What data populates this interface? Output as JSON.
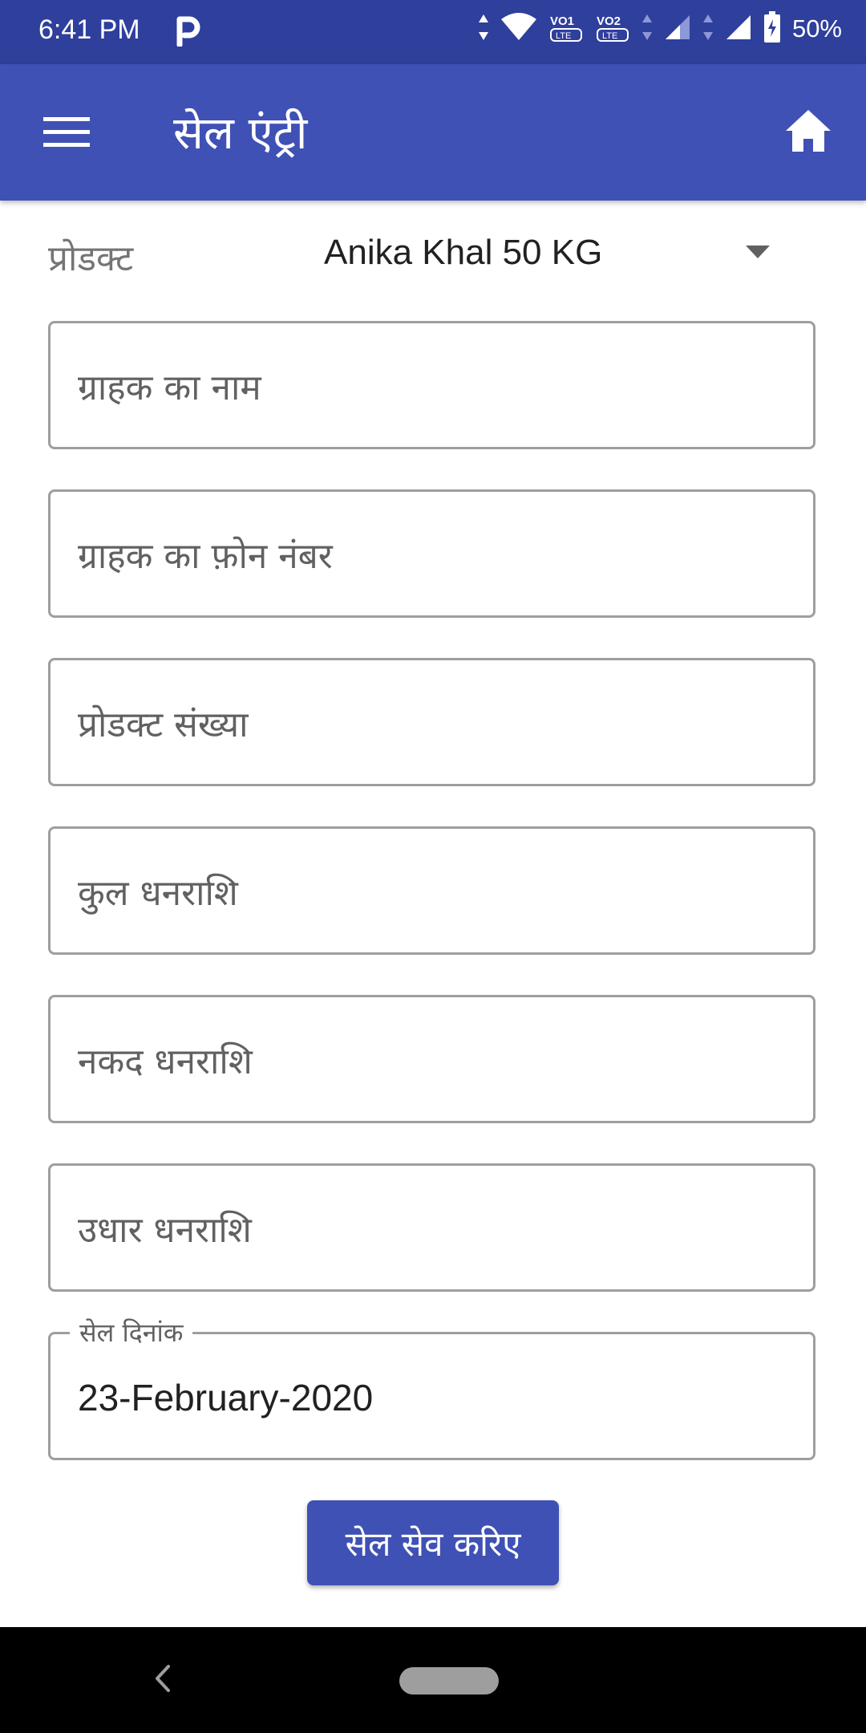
{
  "status_bar": {
    "time": "6:41 PM",
    "battery": "50%",
    "sim1_label": "VO1",
    "sim2_label": "VO2",
    "lte_label": "LTE"
  },
  "app_bar": {
    "title": "सेल एंट्री",
    "menu_icon": "hamburger-menu-icon",
    "home_icon": "home-icon"
  },
  "product": {
    "label": "प्रोडक्ट",
    "selected": "Anika Khal 50 KG"
  },
  "fields": {
    "customer_name": {
      "placeholder": "ग्राहक का नाम"
    },
    "customer_phone": {
      "placeholder": "ग्राहक का फ़ोन नंबर"
    },
    "product_quantity": {
      "placeholder": "प्रोडक्ट संख्या"
    },
    "total_amount": {
      "placeholder": "कुल धनराशि"
    },
    "cash_amount": {
      "placeholder": "नकद धनराशि"
    },
    "credit_amount": {
      "placeholder": "उधार धनराशि"
    },
    "sale_date": {
      "label": "सेल दिनांक",
      "value": "23-February-2020"
    }
  },
  "actions": {
    "save_label": "सेल सेव करिए"
  },
  "colors": {
    "primary": "#3f51b5",
    "primary_dark": "#2f3f9c"
  }
}
